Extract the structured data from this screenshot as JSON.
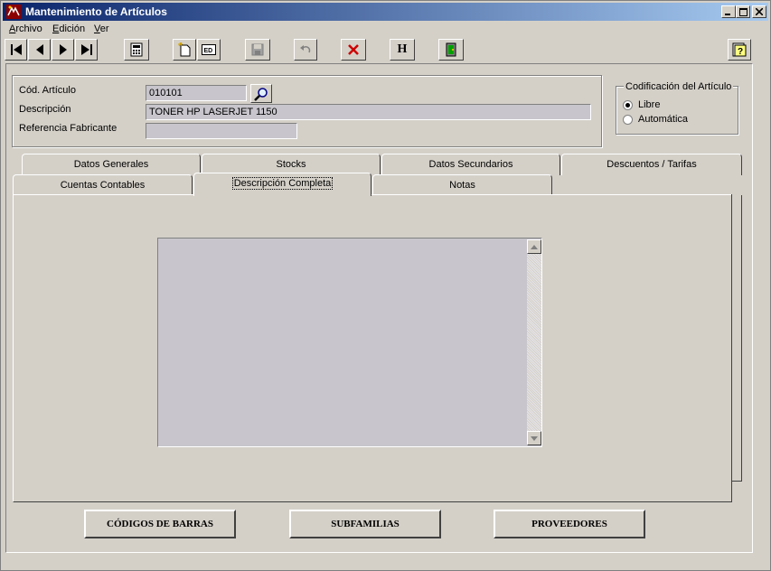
{
  "window": {
    "title": "Mantenimiento de Artículos",
    "icons": {
      "app": "app-logo-icon",
      "minimize": "minimize-icon",
      "maximize": "maximize-icon",
      "close": "close-icon"
    }
  },
  "menu": [
    {
      "label": "Archivo",
      "hotkey": "A"
    },
    {
      "label": "Edición",
      "hotkey": "E"
    },
    {
      "label": "Ver",
      "hotkey": "V"
    }
  ],
  "toolbar": {
    "buttons": [
      "first-record-icon",
      "previous-record-icon",
      "next-record-icon",
      "last-record-icon",
      "calculator-icon",
      "new-record-icon",
      "edit-record-icon",
      "save-icon",
      "undo-icon",
      "delete-icon",
      "history-icon",
      "exit-icon",
      "help-icon"
    ],
    "history_label": "H",
    "edit_label": "ED"
  },
  "form": {
    "codigo_label": "Cód. Artículo",
    "codigo_value": "010101",
    "descripcion_label": "Descripción",
    "descripcion_value": "TONER HP LASERJET 1150",
    "referencia_label": "Referencia Fabricante",
    "referencia_value": ""
  },
  "codificacion": {
    "legend": "Codificación del Artículo",
    "options": [
      {
        "label": "Libre",
        "selected": true
      },
      {
        "label": "Automática",
        "selected": false
      }
    ]
  },
  "tabs": {
    "row_back": [
      "Datos Generales",
      "Stocks",
      "Datos Secundarios",
      "Descuentos / Tarifas"
    ],
    "row_front": [
      "Cuentas Contables",
      "Descripción Completa",
      "Notas"
    ],
    "active": "Descripción Completa"
  },
  "memo": {
    "value": ""
  },
  "bottom_buttons": [
    "CÓDIGOS DE BARRAS",
    "SUBFAMILIAS",
    "PROVEEDORES"
  ],
  "colors": {
    "title_start": "#0a246a",
    "title_end": "#a6caf0",
    "face": "#d4d0c8",
    "field": "#c8c6cc",
    "delete": "#cc0000"
  }
}
